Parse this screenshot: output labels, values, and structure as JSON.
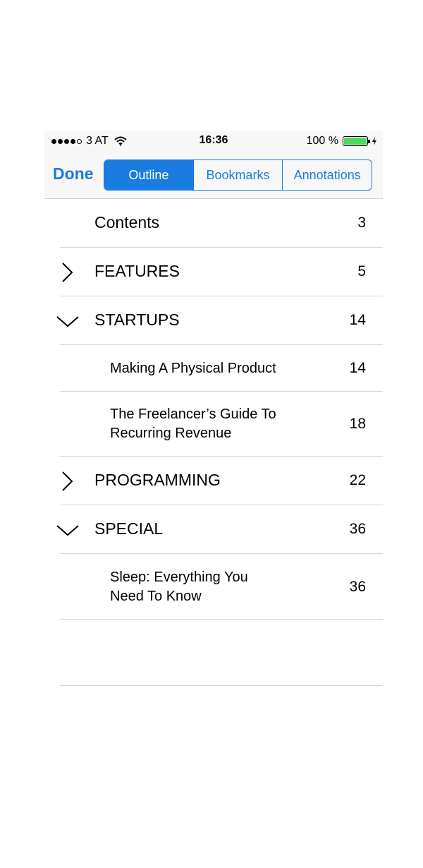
{
  "status_bar": {
    "carrier": "3 AT",
    "time": "16:36",
    "battery_text": "100 %",
    "battery_level": 1.0,
    "battery_color": "#4cd964"
  },
  "nav": {
    "done_label": "Done",
    "tabs": [
      {
        "label": "Outline",
        "active": true
      },
      {
        "label": "Bookmarks",
        "active": false
      },
      {
        "label": "Annotations",
        "active": false
      }
    ],
    "accent_color": "#1a7ce0"
  },
  "outline": [
    {
      "title": "Contents",
      "page": "3",
      "level": 0,
      "chevron": ""
    },
    {
      "title": "FEATURES",
      "page": "5",
      "level": 0,
      "chevron": "chevron-right-icon"
    },
    {
      "title": "STARTUPS",
      "page": "14",
      "level": 0,
      "chevron": "chevron-down-icon"
    },
    {
      "title": "Making A Physical Product",
      "page": "14",
      "level": 1
    },
    {
      "title_line1": "The Freelancer’s Guide To",
      "title_line2": "Recurring Revenue",
      "page": "18",
      "level": 1
    },
    {
      "title": "PROGRAMMING",
      "page": "22",
      "level": 0,
      "chevron": "chevron-right-icon"
    },
    {
      "title": "SPECIAL",
      "page": "36",
      "level": 0,
      "chevron": "chevron-down-icon"
    },
    {
      "title_line1": "Sleep: Everything You",
      "title_line2": "Need To Know",
      "page": "36",
      "level": 1
    }
  ]
}
